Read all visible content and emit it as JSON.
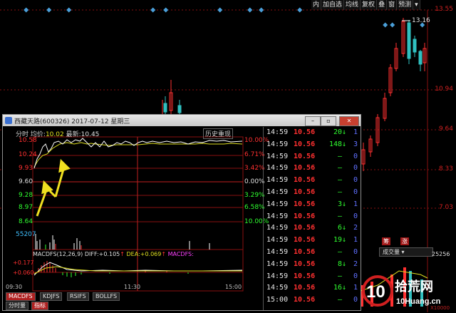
{
  "toolbar": {
    "items": [
      "内",
      "加自选",
      "均线",
      "复权",
      "叠",
      "窗",
      "预测"
    ],
    "dropdown": "▾"
  },
  "background_chart": {
    "axis_labels": [
      "13.55",
      "10.94",
      "9.64",
      "8.33",
      "7.03"
    ],
    "high_label": "13.16",
    "bottom_tags": [
      "筹",
      "涨"
    ],
    "vol_select": "成交量",
    "vol_label": "25256",
    "unit_label": "X10000"
  },
  "window": {
    "title": "西藏天路(600326)  2017-07-12 星期三",
    "buttons": [
      "–",
      "▫",
      "▣",
      "✕"
    ]
  },
  "chart_header": {
    "label_fs": "分时",
    "label_avg": "均价:",
    "avg_value": "10.02",
    "label_last": "最新:",
    "last_value": "10.45",
    "history_button": "历史重现"
  },
  "left_axis": [
    "10.58",
    "10.24",
    "9.93",
    "9.60",
    "9.28",
    "8.97",
    "8.64"
  ],
  "right_axis": [
    "10.00%",
    "6.71%",
    "3.42%",
    "0.00%",
    "3.29%",
    "6.58%",
    "10.00%"
  ],
  "volume_label": "55207",
  "macd": {
    "title": "MACDFS(12,26,9)",
    "diff_label": "DIFF:",
    "diff_value": "+0.105",
    "dea_label": "DEA:",
    "dea_value": "+0.069",
    "series_name": "MACDFS:",
    "axis_top": "+0.177",
    "axis_mid": "+0.060"
  },
  "time_axis": [
    "09:30",
    "11:30",
    "15:00"
  ],
  "tabs": [
    "MACDFS",
    "KDJFS",
    "RSIFS",
    "BOLLFS"
  ],
  "sub_tabs": [
    "分时量",
    "指标"
  ],
  "ticks": [
    {
      "time": "14:59",
      "price": "10.56",
      "vol": "20",
      "dir": "down",
      "count": "1"
    },
    {
      "time": "14:59",
      "price": "10.56",
      "vol": "148",
      "dir": "down",
      "count": "3"
    },
    {
      "time": "14:59",
      "price": "10.56",
      "vol": "–",
      "dir": "",
      "count": "0"
    },
    {
      "time": "14:59",
      "price": "10.56",
      "vol": "–",
      "dir": "",
      "count": "0"
    },
    {
      "time": "14:59",
      "price": "10.56",
      "vol": "–",
      "dir": "",
      "count": "0"
    },
    {
      "time": "14:59",
      "price": "10.56",
      "vol": "–",
      "dir": "",
      "count": "0"
    },
    {
      "time": "14:59",
      "price": "10.56",
      "vol": "3",
      "dir": "down",
      "count": "1"
    },
    {
      "time": "14:59",
      "price": "10.56",
      "vol": "–",
      "dir": "",
      "count": "0"
    },
    {
      "time": "14:59",
      "price": "10.56",
      "vol": "6",
      "dir": "down",
      "count": "2"
    },
    {
      "time": "14:59",
      "price": "10.56",
      "vol": "19",
      "dir": "down",
      "count": "1"
    },
    {
      "time": "14:59",
      "price": "10.56",
      "vol": "–",
      "dir": "",
      "count": "0"
    },
    {
      "time": "14:59",
      "price": "10.56",
      "vol": "8",
      "dir": "down",
      "count": "2"
    },
    {
      "time": "14:59",
      "price": "10.56",
      "vol": "–",
      "dir": "",
      "count": "0"
    },
    {
      "time": "14:59",
      "price": "10.56",
      "vol": "16",
      "dir": "down",
      "count": "1"
    },
    {
      "time": "15:00",
      "price": "10.56",
      "vol": "–",
      "dir": "",
      "count": "0"
    }
  ],
  "watermark": {
    "text": "拾荒网",
    "sub": "10Huang.cn",
    "num": "10"
  },
  "colors": {
    "up": "#ff3030",
    "down": "#30ff30",
    "grid": "#8a1010",
    "price_line": "#ffffff",
    "avg_line": "#e0e020",
    "count": "#6070ff"
  }
}
